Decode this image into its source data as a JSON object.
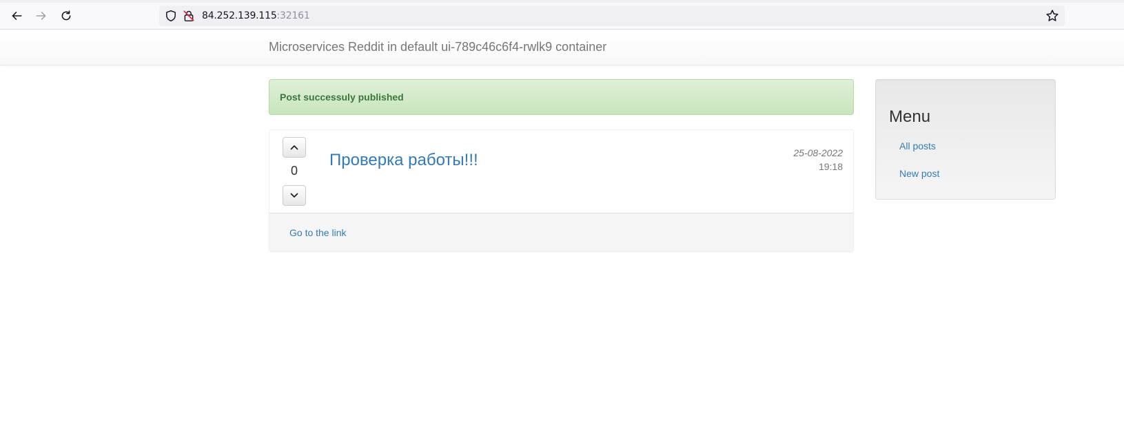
{
  "browser": {
    "url_host": "84.252.139.115",
    "url_port": ":32161"
  },
  "app": {
    "brand": "Microservices Reddit in default ui-789c46c6f4-rwlk9 container"
  },
  "alert": {
    "message": "Post successuly published",
    "color": "#3c763d"
  },
  "post": {
    "votes": "0",
    "title": "Проверка работы!!!",
    "date": "25-08-2022",
    "time": "19:18",
    "footer_link": "Go to the link"
  },
  "sidebar": {
    "title": "Menu",
    "items": [
      {
        "label": "All posts"
      },
      {
        "label": "New post"
      }
    ]
  },
  "colors": {
    "link": "#337ab7",
    "brand_text": "#777777"
  }
}
